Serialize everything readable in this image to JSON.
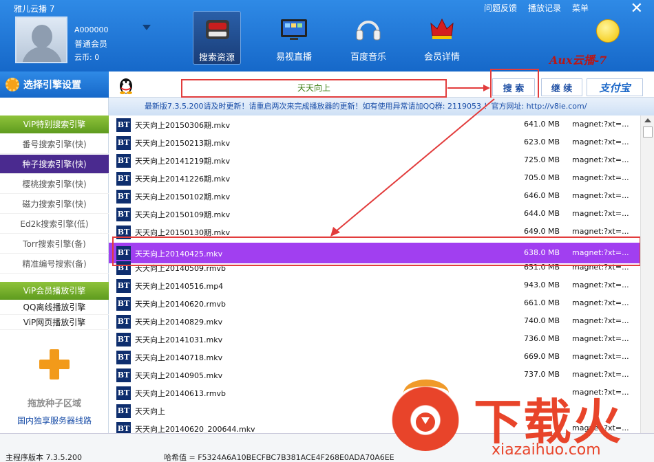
{
  "app": {
    "title": "雅儿云播 7"
  },
  "header": {
    "links": [
      "问题反馈",
      "播放记录",
      "菜单"
    ],
    "close": "✕",
    "user": {
      "id": "A000000",
      "level": "普通会员",
      "coins": "云币: 0"
    },
    "tabs": [
      {
        "label": "搜索资源",
        "icon": "search-resource-icon",
        "active": true
      },
      {
        "label": "易视直播",
        "icon": "tv-icon",
        "active": false
      },
      {
        "label": "百度音乐",
        "icon": "headphones-icon",
        "active": false
      },
      {
        "label": "会员详情",
        "icon": "crown-icon",
        "active": false
      }
    ],
    "brand": "Aux云播-7"
  },
  "toolbar": {
    "engine_settings": "选择引擎设置",
    "query": "天天向上",
    "search": "搜 索",
    "continue": "继 续",
    "alipay": "支付宝"
  },
  "notice": "最新版7.3.5.200请及时更新！请重启两次来完成播放器的更新！如有使用异常请加QQ群: 2119053 ！官方网址: http://v8ie.com/",
  "sidebar": {
    "vip_search_head": "ViP特别搜索引擎",
    "search_engines": [
      {
        "label": "番号搜索引擎(快)",
        "active": false
      },
      {
        "label": "种子搜索引擎(快)",
        "active": true
      },
      {
        "label": "樱桃搜索引擎(快)",
        "active": false
      },
      {
        "label": "磁力搜索引擎(快)",
        "active": false
      },
      {
        "label": "Ed2k搜索引擎(低)",
        "active": false
      },
      {
        "label": "Torr搜索引擎(备)",
        "active": false
      },
      {
        "label": "精准编号搜索(备)",
        "active": false
      }
    ],
    "vip_play_head": "ViP会员播放引擎",
    "play_engines": [
      "QQ离线播放引擎",
      "ViP网页播放引擎"
    ],
    "drop_label": "拖放种子区域",
    "server_line": "国内独享服务器线路"
  },
  "results": [
    {
      "name": "天天向上20150306期.mkv",
      "size": "641.0 MB",
      "magnet": "magnet:?xt=..."
    },
    {
      "name": "天天向上20150213期.mkv",
      "size": "623.0 MB",
      "magnet": "magnet:?xt=..."
    },
    {
      "name": "天天向上20141219期.mkv",
      "size": "725.0 MB",
      "magnet": "magnet:?xt=..."
    },
    {
      "name": "天天向上20141226期.mkv",
      "size": "705.0 MB",
      "magnet": "magnet:?xt=..."
    },
    {
      "name": "天天向上20150102期.mkv",
      "size": "646.0 MB",
      "magnet": "magnet:?xt=..."
    },
    {
      "name": "天天向上20150109期.mkv",
      "size": "644.0 MB",
      "magnet": "magnet:?xt=..."
    },
    {
      "name": "天天向上20150130期.mkv",
      "size": "649.0 MB",
      "magnet": "magnet:?xt=..."
    },
    {
      "name": "天天向上20140425.mkv",
      "size": "638.0 MB",
      "magnet": "magnet:?xt=...",
      "selected": true
    },
    {
      "name": "天天向上20140509.rmvb",
      "size": "651.0 MB",
      "magnet": "magnet:?xt=..."
    },
    {
      "name": "天天向上20140516.mp4",
      "size": "943.0 MB",
      "magnet": "magnet:?xt=..."
    },
    {
      "name": "天天向上20140620.rmvb",
      "size": "661.0 MB",
      "magnet": "magnet:?xt=..."
    },
    {
      "name": "天天向上20140829.mkv",
      "size": "740.0 MB",
      "magnet": "magnet:?xt=..."
    },
    {
      "name": "天天向上20141031.mkv",
      "size": "736.0 MB",
      "magnet": "magnet:?xt=..."
    },
    {
      "name": "天天向上20140718.mkv",
      "size": "669.0 MB",
      "magnet": "magnet:?xt=..."
    },
    {
      "name": "天天向上20140905.mkv",
      "size": "737.0 MB",
      "magnet": "magnet:?xt=..."
    },
    {
      "name": "天天向上20140613.rmvb",
      "size": "",
      "magnet": "magnet:?xt=..."
    },
    {
      "name": "天天向上",
      "size": "",
      "magnet": ""
    },
    {
      "name": "天天向上20140620_200644.mkv",
      "size": "",
      "magnet": "magnet:?xt=..."
    }
  ],
  "status": {
    "version": "主程序版本  7.3.5.200",
    "hash": "哈希值 = F5324A6A10BECFBC7B381ACE4F268E0ADA70A6EE"
  },
  "watermark": {
    "cn": "下载火",
    "url": "xiazaihuo.com"
  }
}
